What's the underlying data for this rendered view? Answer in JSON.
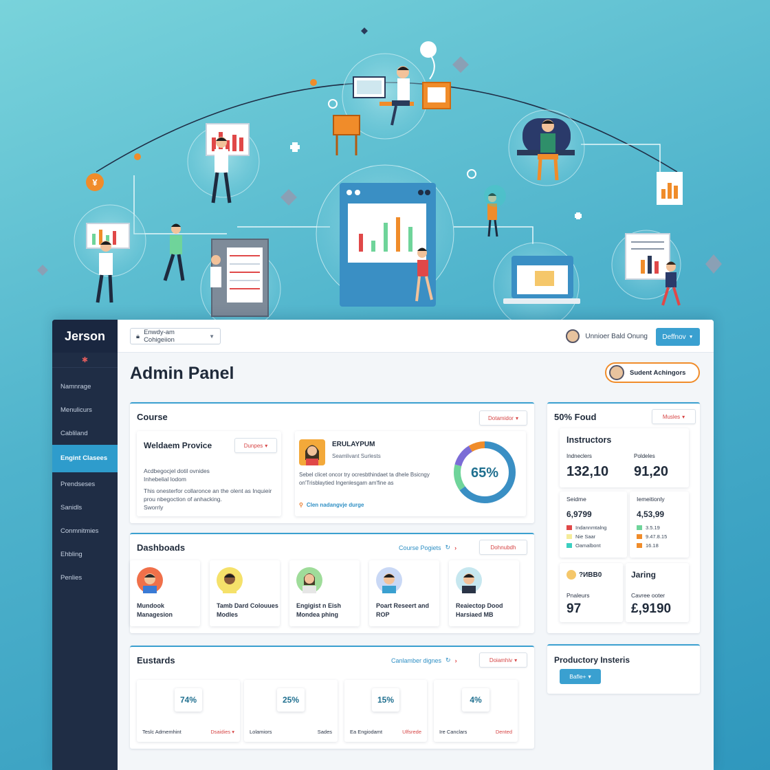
{
  "colors": {
    "accent": "#3aa0d0",
    "sidebar": "#1f2d45",
    "orange": "#f08c2a",
    "red": "#d64545",
    "green": "#6fd49a",
    "purple": "#7b6cd6"
  },
  "sidebar": {
    "brand": "Jerson",
    "items": [
      {
        "label": "Namnrage"
      },
      {
        "label": "Menulicurs"
      },
      {
        "label": "Cabliland"
      },
      {
        "label": "Engint Clasees",
        "active": true
      },
      {
        "label": "Prendseses"
      },
      {
        "label": "Sanidls"
      },
      {
        "label": "Conmnitmies"
      },
      {
        "label": "Ehbling"
      },
      {
        "label": "Penlies"
      }
    ]
  },
  "topbar": {
    "dropdown": "Enwdy-am Cohigeiion",
    "user_name": "Unnioer Bald Onung",
    "primary_button": "Deffnov"
  },
  "page": {
    "title": "Admin Panel",
    "pill_button": "Sudent Achingors"
  },
  "course": {
    "title": "Course",
    "button": "Dotamidor",
    "left": {
      "title": "Weldaem Provice",
      "button": "Dunpes",
      "line1": "Acdbegocjel dotil ovnides",
      "line2": "Inhebelial lodom",
      "line3": "This onesterfor collaronce an the olent as Inquieir prou nbegoction of anhacking.",
      "line4": "Sworrly"
    },
    "featured": {
      "title": "ERULAYPUM",
      "subtitle": "Seamlivant Surlests",
      "body": "Sebel clicet oncor try ocresbthindaet ta dhele Bsicngy on'Trisblaytied Ingenlesgam am'fine as",
      "link": "Clen nadangvje durge",
      "percent": "65%",
      "progress": 0.65
    }
  },
  "dashboards": {
    "title": "Dashboads",
    "link": "Course Pogiets",
    "button": "Dohnubdh",
    "people": [
      {
        "label": "Mundook Managesion",
        "skin": "#f2c29a",
        "bg": "#f0704a",
        "hair": "#2a2a2a",
        "shirt": "#3a7bd5"
      },
      {
        "label": "Tamb Dard Colouues Modles",
        "skin": "#8a5a3a",
        "bg": "#f5e16a",
        "hair": "#1e1e1e",
        "shirt": "#f5e16a"
      },
      {
        "label": "Engigist n Eish Mondea phing",
        "skin": "#f2c29a",
        "bg": "#9fdc9a",
        "hair": "#3b2a1e",
        "shirt": "#e6e6e6"
      },
      {
        "label": "Poart Reseert and ROP",
        "skin": "#f2c29a",
        "bg": "#c9d8f5",
        "hair": "#1e1e1e",
        "shirt": "#3aa0d0"
      },
      {
        "label": "Reaiectop Dood Harsiaed MB",
        "skin": "#f2c29a",
        "bg": "#c6e7ef",
        "hair": "#1e1e1e",
        "shirt": "#2a3446"
      }
    ]
  },
  "eustards": {
    "title": "Eustards",
    "link": "Canlamber dignes",
    "button": "Doiamhiv",
    "stats": [
      {
        "value": "74%",
        "left": "Teslc Admemhint",
        "right": "Dsaidies"
      },
      {
        "value": "25%",
        "left": "Lolamiors",
        "right": "Sades"
      },
      {
        "value": "15%",
        "left": "Ea Engiodamt",
        "right": "Ulfsrede"
      },
      {
        "value": "4%",
        "left": "Ire Canclars",
        "right": "Dented"
      }
    ]
  },
  "right_panel": {
    "title": "50% Foud",
    "button": "Musles",
    "instructors": {
      "title": "Instructors",
      "k1_label": "Indneclers",
      "k1_value": "132,10",
      "k2_label": "Poldeles",
      "k2_value": "91,20"
    },
    "stats2": {
      "a_label": "Seidme",
      "a_value": "6,9799",
      "a_legend": [
        "Indannmtalng",
        "Nie Saar",
        "Oamalbont"
      ],
      "b_label": "Iemeitionly",
      "b_value": "4,53,99",
      "b_legend": [
        "3.5.19",
        "9.47.8.15",
        "16.18"
      ]
    },
    "stats3": {
      "a_label": "Pnaleurs",
      "a_value": "97",
      "a_badge": "?ИBB0",
      "b_label": "Cavree ooter",
      "b_value": "£,9190",
      "b_title": "Jaring"
    }
  },
  "productory": {
    "title": "Productory Insteris",
    "button": "Bafle+"
  },
  "hero_icons": [
    "yen-coin-icon",
    "chart-board-icon",
    "laptop-icon",
    "dashboard-screen-icon",
    "bar-chart-card-icon"
  ]
}
